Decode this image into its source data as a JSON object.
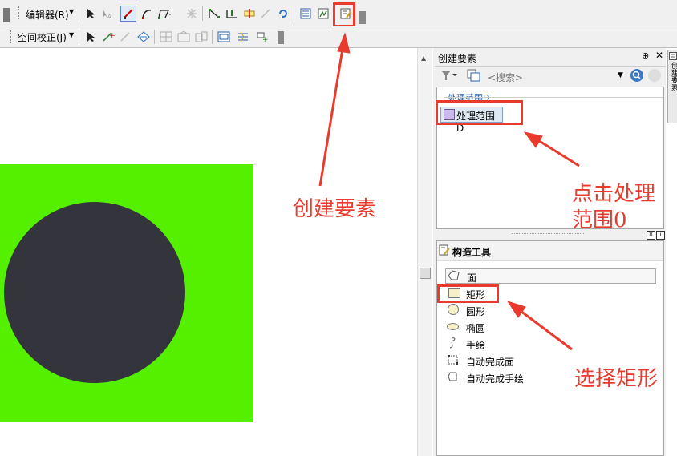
{
  "toolbar": {
    "editor_label": "编辑器(R)",
    "spatial_adjust_label": "空间校正(J)"
  },
  "create_features": {
    "title": "创建要素",
    "pin": "⊕",
    "close": "✕",
    "search_placeholder": "<搜索>",
    "group_label": "处理范围D",
    "item_label": "处理范围D",
    "side_tab_label": "创建要素"
  },
  "construction_tools": {
    "title": "构造工具",
    "items": [
      {
        "label": "面",
        "icon": "polygon-icon"
      },
      {
        "label": "矩形",
        "icon": "rectangle-icon"
      },
      {
        "label": "圆形",
        "icon": "circle-icon"
      },
      {
        "label": "椭圆",
        "icon": "ellipse-icon"
      },
      {
        "label": "手绘",
        "icon": "freehand-icon"
      },
      {
        "label": "自动完成面",
        "icon": "auto-complete-polygon-icon"
      },
      {
        "label": "自动完成手绘",
        "icon": "auto-complete-freehand-icon"
      }
    ]
  },
  "annotations": {
    "create_features": "创建要素",
    "click_layer_line1": "点击处理",
    "click_layer_line2": "范围0",
    "select_rectangle": "选择矩形"
  },
  "colors": {
    "map_green": "#55f000",
    "circle_dark": "#34343c",
    "annotation_red": "#e83b2e"
  }
}
